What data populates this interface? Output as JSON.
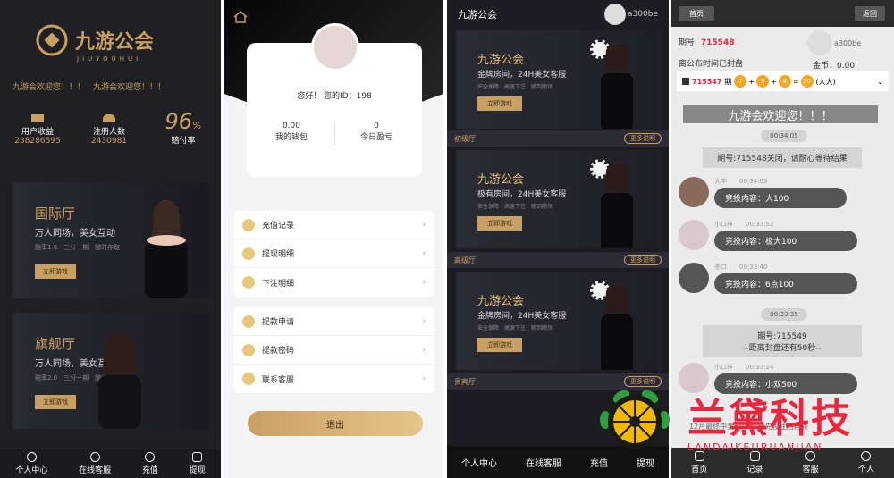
{
  "p1": {
    "logo_title": "九游公会",
    "logo_sub": "JIUYOUHUI",
    "marquee": "九游会欢迎您！！！　九游会欢迎您！！！",
    "stats": [
      {
        "label": "用户收益",
        "value": "238286595"
      },
      {
        "label": "注册人数",
        "value": "2430981"
      },
      {
        "label": "赔付率",
        "value": "96",
        "unit": "%"
      }
    ],
    "cards": [
      {
        "title": "国际厅",
        "subtitle": "万人同场，美女互动",
        "detail": "赔率1.6　三分一期　随时存取",
        "button": "立即游戏"
      },
      {
        "title": "旗舰厅",
        "subtitle": "万人同场，美女互动",
        "detail": "赔率2.0　三分一期　随时存取",
        "button": "立即游戏"
      }
    ],
    "tabs": [
      "个人中心",
      "在线客服",
      "充值",
      "提现"
    ]
  },
  "p2": {
    "greeting": "您好！ 您的ID：198",
    "balance_value": "0.00",
    "balance_label": "我的钱包",
    "profit_value": "0",
    "profit_label": "今日盈亏",
    "menu1": [
      "充值记录",
      "提现明细",
      "下注明细"
    ],
    "menu2": [
      "提款申请",
      "提款密码",
      "联系客服"
    ],
    "logout": "退出"
  },
  "p3": {
    "title": "九游公会",
    "user": "a300be",
    "rooms": [
      {
        "title": "九游公会",
        "subtitle": "金牌房间，24H美女客服",
        "detail": "安全保障　高速下注　随到随领",
        "button": "立即游戏",
        "bar": "初级厅"
      },
      {
        "title": "九游公会",
        "subtitle": "极有房间，24H美女客服",
        "detail": "安全保障　高速下注　随到随领",
        "button": "立即游戏",
        "bar": "高级厅"
      },
      {
        "title": "九游公会",
        "subtitle": "金牌房间，24H美女客服",
        "detail": "安全保障　高速下注　随到随领",
        "button": "立即游戏",
        "bar": "贵宾厅"
      }
    ],
    "more": "更多说明",
    "tabs": [
      "个人中心",
      "在线客服",
      "充值",
      "提现"
    ]
  },
  "p4": {
    "home": "首页",
    "back": "返回",
    "period_label": "期号",
    "period": "715548",
    "closing": "离公布时间已封盘",
    "user": "a300be",
    "coins_label": "金币：",
    "coins": "0.00",
    "draw_period": "715547",
    "draw_label": "期",
    "balls": [
      "7",
      "9",
      "4",
      "20"
    ],
    "draw_result": "(大大)",
    "welcome": "九游会欢迎您！！！",
    "times": [
      "00:34:05",
      "00:33:35"
    ],
    "sys1": "期号:715548关闭，请耐心等待结果",
    "sys2_line1": "期号:715549",
    "sys2_line2": "--距离封盘还有50秒--",
    "messages": [
      {
        "name": "大中",
        "time": "00:34:03",
        "text": "竞投内容：大100"
      },
      {
        "name": "小口祥",
        "time": "00:33:52",
        "text": "竞投内容：极大100"
      },
      {
        "name": "冬口",
        "time": "00:33:40",
        "text": "竞投内容：6点100"
      },
      {
        "name": "小口祥",
        "time": "00:33:24",
        "text": "竞投内容：小双500"
      }
    ],
    "bottom_text": "12月最终中奖前一名 请先投注后再领",
    "tabs": [
      "首页",
      "记录",
      "客服",
      "个人"
    ]
  },
  "watermark": {
    "cn": "兰黛科技",
    "en": "LANDAIKEJIRUANJIAN"
  },
  "colors": {
    "gold": "#c9a064",
    "dark": "#1f1f24",
    "red": "#e8273f"
  }
}
